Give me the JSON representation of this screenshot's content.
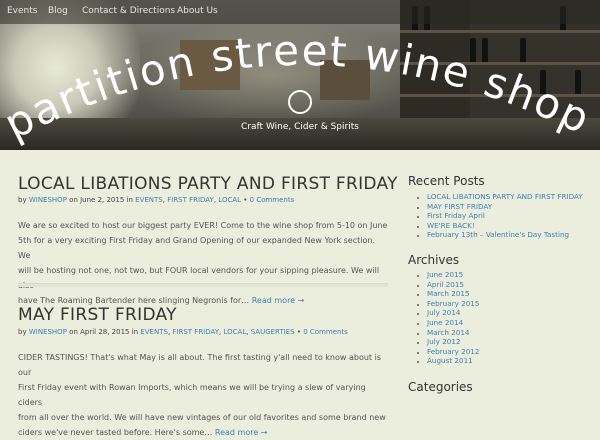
{
  "nav": {
    "items": [
      "Events",
      "Blog",
      "Contact & Directions",
      "About Us"
    ]
  },
  "header": {
    "title": "partition street wine shop",
    "tagline": "Craft Wine, Cider & Spirits"
  },
  "posts": [
    {
      "title": "LOCAL LIBATIONS PARTY AND FIRST FRIDAY",
      "by": "by",
      "author": "WINESHOP",
      "on": "on June 2, 2015 in",
      "categories": [
        "EVENTS",
        "FIRST FRIDAY",
        "LOCAL"
      ],
      "comments": "0 Comments",
      "excerpt_lines": [
        "We are so excited to host our biggest party EVER! Come to the wine shop from 5-10 on June",
        "5th for a very exciting First Friday and Grand Opening of our expanded New York section. We",
        "will be hosting not one, not two, but FOUR local vendors for your sipping pleasure. We will also",
        "have The Roaming Bartender here slinging Negronis for…"
      ],
      "read_more": "Read more →"
    },
    {
      "title": "MAY FIRST FRIDAY",
      "by": "by",
      "author": "WINESHOP",
      "on": "on April 28, 2015 in",
      "categories": [
        "EVENTS",
        "FIRST FRIDAY",
        "LOCAL",
        "SAUGERTIES"
      ],
      "comments": "0 Comments",
      "excerpt_lines": [
        "CIDER TASTINGS!  That's what May is all about. The first tasting y'all need to know about is our",
        "First Friday event with Rowan Imports, which means we will be trying a slew of varying ciders",
        "from all over the world. We will have new vintages of our old favorites and some brand new",
        "ciders we've never tasted before. Here's some…"
      ],
      "read_more": "Read more →"
    }
  ],
  "sidebar": {
    "recent_title": "Recent Posts",
    "recent": [
      "LOCAL LIBATIONS PARTY AND FIRST FRIDAY",
      "MAY FIRST FRIDAY",
      "First Friday April",
      "WE'RE BACK!",
      "February 13th – Valentine's Day Tasting"
    ],
    "archives_title": "Archives",
    "archives": [
      "June 2015",
      "April 2015",
      "March 2015",
      "February 2015",
      "July 2014",
      "June 2014",
      "March 2014",
      "July 2012",
      "February 2012",
      "August 2011"
    ],
    "categories_title": "Categories"
  }
}
